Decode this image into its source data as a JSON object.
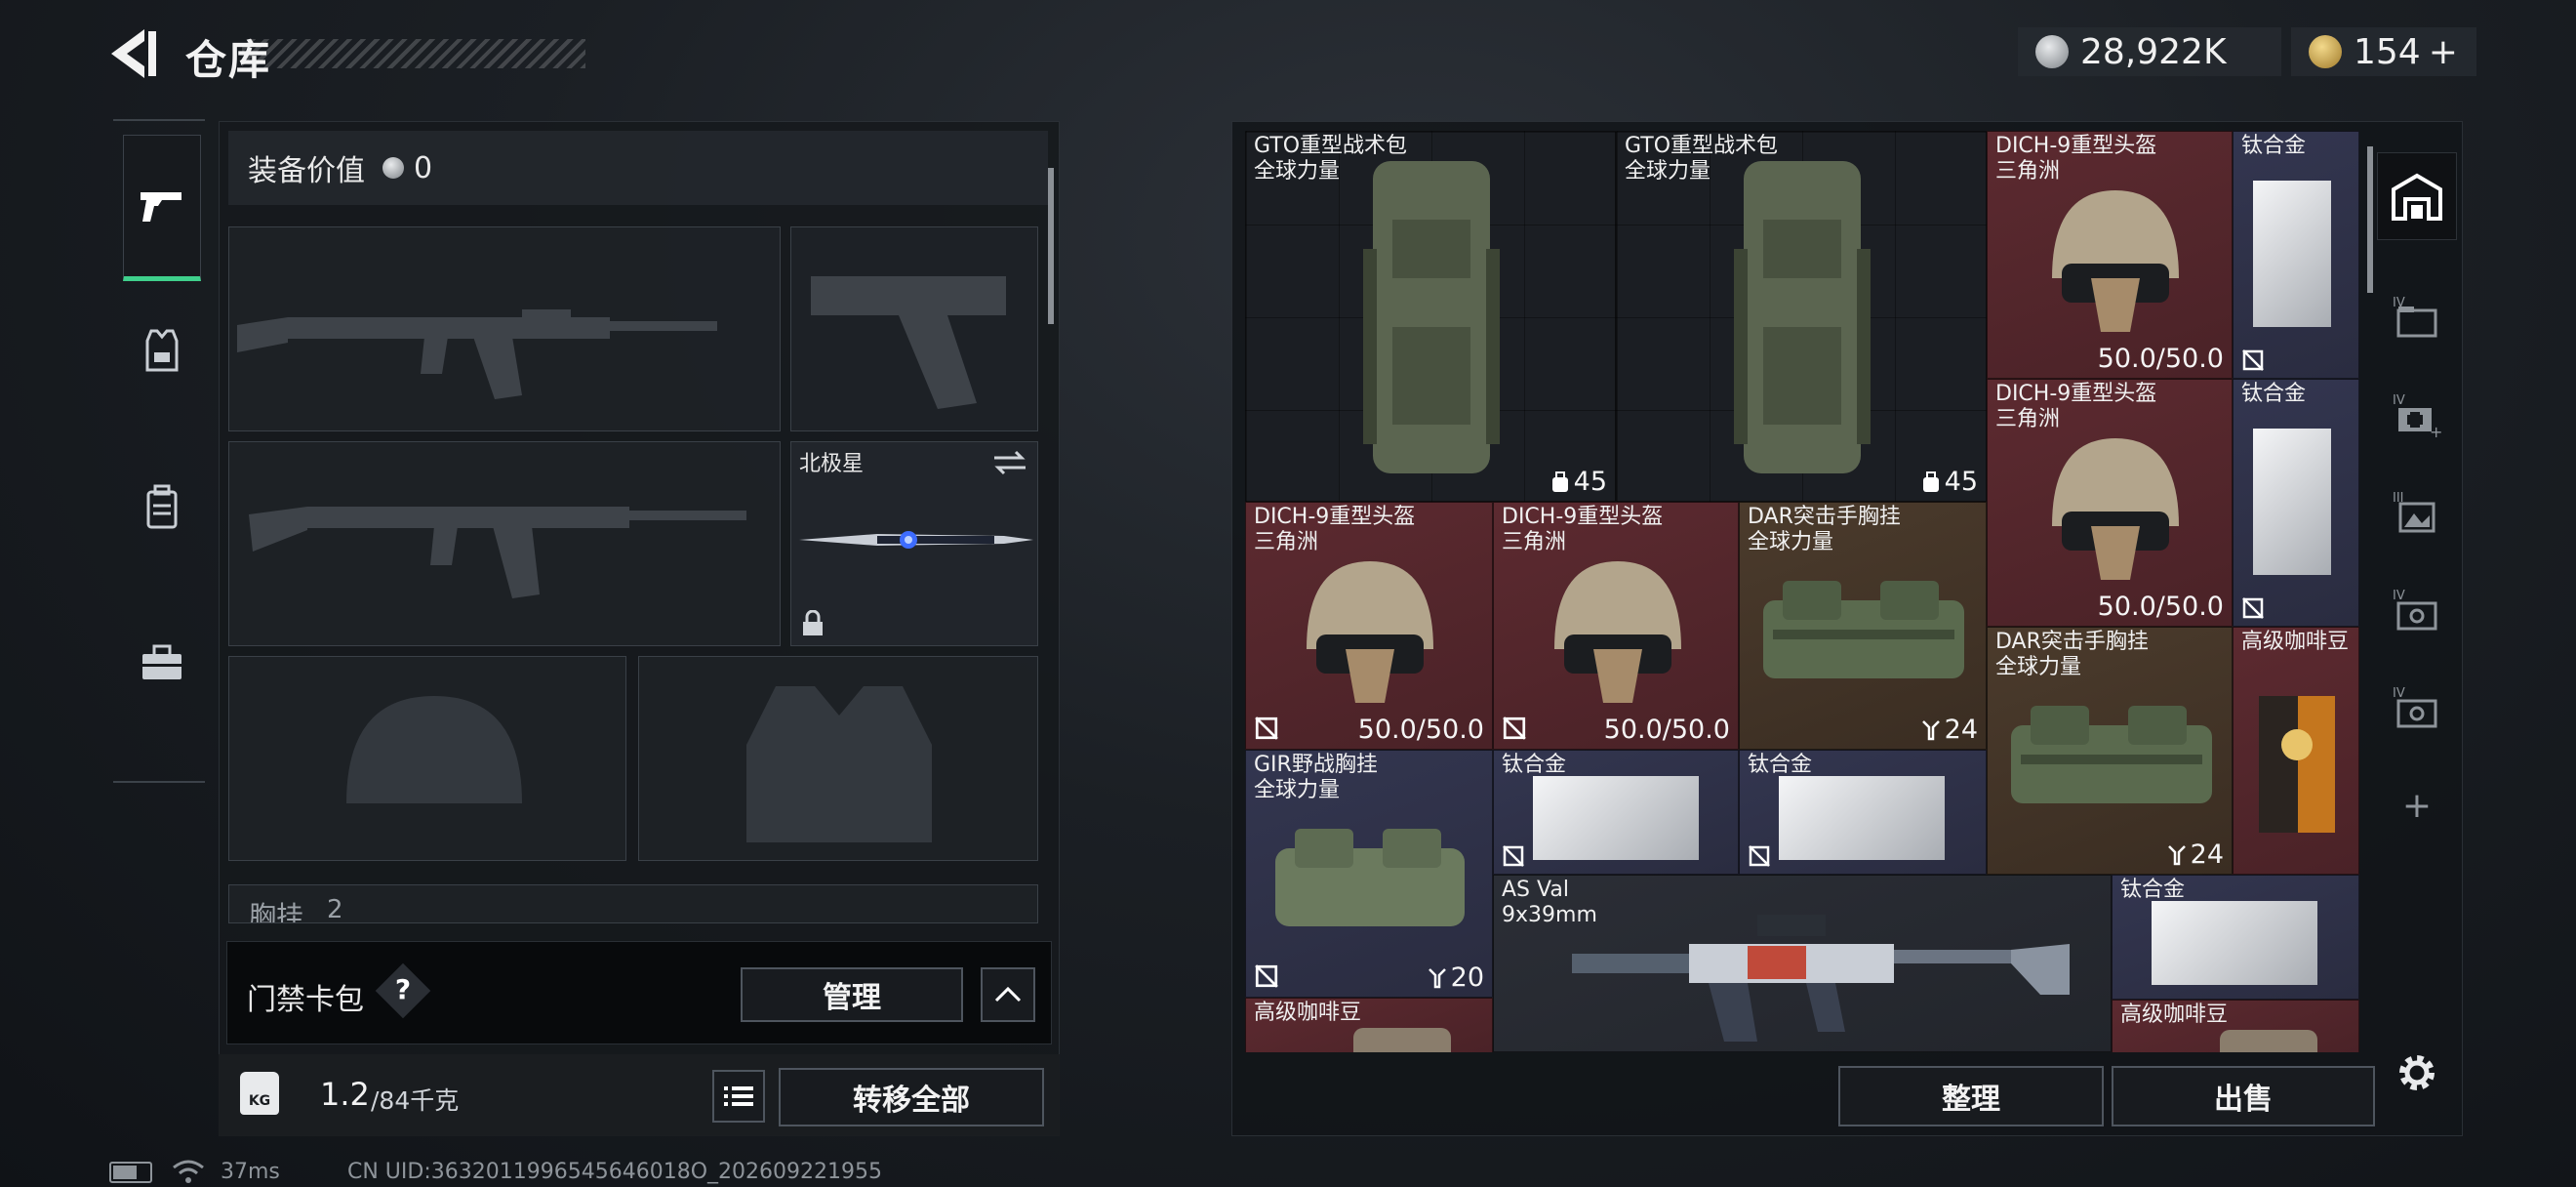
{
  "header": {
    "title": "仓库",
    "currency_silver": "28,922K",
    "currency_gold": "154",
    "currency_plus": "+"
  },
  "left_tabs": [
    "pistol-icon",
    "armor-vest-icon",
    "backpack-icon",
    "toolbox-icon"
  ],
  "equipment": {
    "value_label": "装备价值",
    "value": "0",
    "melee_name": "北极星",
    "chest_rig_label": "胸挂",
    "chest_rig_count": "2"
  },
  "card_pack": {
    "label": "门禁卡包",
    "help": "?",
    "manage_button": "管理"
  },
  "weight": {
    "icon_label": "KG",
    "current": "1.2",
    "max": "/84千克",
    "transfer_button": "转移全部"
  },
  "storage": {
    "items": [
      {
        "name": "GTO重型战术包",
        "sub": "全球力量",
        "value": "45"
      },
      {
        "name": "GTO重型战术包",
        "sub": "全球力量",
        "value": "45"
      },
      {
        "name": "DICH-9重型头盔",
        "sub": "三角洲",
        "value": "50.0/50.0"
      },
      {
        "name": "钛合金",
        "sub": "",
        "value": ""
      },
      {
        "name": "DICH-9重型头盔",
        "sub": "三角洲",
        "value": "50.0/50.0"
      },
      {
        "name": "钛合金",
        "sub": "",
        "value": ""
      },
      {
        "name": "DICH-9重型头盔",
        "sub": "三角洲",
        "value": "50.0/50.0"
      },
      {
        "name": "DICH-9重型头盔",
        "sub": "三角洲",
        "value": "50.0/50.0"
      },
      {
        "name": "DAR突击手胸挂",
        "sub": "全球力量",
        "value": "24"
      },
      {
        "name": "DAR突击手胸挂",
        "sub": "全球力量",
        "value": "24"
      },
      {
        "name": "高级咖啡豆",
        "sub": "",
        "value": ""
      },
      {
        "name": "GIR野战胸挂",
        "sub": "全球力量",
        "value": "20"
      },
      {
        "name": "钛合金",
        "sub": "",
        "value": ""
      },
      {
        "name": "钛合金",
        "sub": "",
        "value": ""
      },
      {
        "name": "AS Val",
        "sub": "9x39mm",
        "value": ""
      },
      {
        "name": "钛合金",
        "sub": "",
        "value": ""
      },
      {
        "name": "高级咖啡豆",
        "sub": "",
        "value": ""
      },
      {
        "name": "高级咖啡豆",
        "sub": "",
        "value": ""
      }
    ],
    "sort_button": "整理",
    "sell_button": "出售"
  },
  "side_tabs": {
    "add": "+"
  },
  "status": {
    "ping": "37ms",
    "uid": "CN UID:3632011996545646018O_202609221955"
  },
  "colors": {
    "accent_green": "#3fd08c",
    "rarity_red": "#5c2a30",
    "rarity_blue": "#333650",
    "rarity_gold": "#4b3b2c"
  }
}
